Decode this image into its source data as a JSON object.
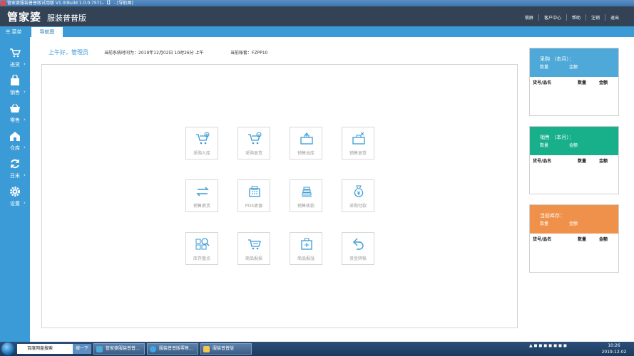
{
  "window": {
    "title": "管家婆服装普普版试用版 V1.0(Build 1.0.0.757)--【】 - [导航图]"
  },
  "header": {
    "logo": "管家婆",
    "edition": "服装普普版",
    "menu": [
      "锁屏",
      "客户中心",
      "帮助",
      "注销",
      "退出"
    ]
  },
  "tabs": {
    "menu_label": "菜单",
    "active_tab": "导航图"
  },
  "sidebar": {
    "items": [
      {
        "label": "进货",
        "icon": "cart-icon"
      },
      {
        "label": "销售",
        "icon": "bag-icon"
      },
      {
        "label": "零售",
        "icon": "basket-icon"
      },
      {
        "label": "仓库",
        "icon": "warehouse-icon"
      },
      {
        "label": "日末",
        "icon": "refresh-icon"
      },
      {
        "label": "设置",
        "icon": "gear-icon"
      }
    ]
  },
  "main": {
    "greeting": "上午好，管理员",
    "systime_label": "当前系统时间为：",
    "systime": "2019年12月02日 10时26分 上午",
    "account_label": "当前账套：",
    "account": "FZPP10"
  },
  "tiles": [
    {
      "label": "采购入库",
      "icon": "cart-add-icon"
    },
    {
      "label": "采购退货",
      "icon": "cart-return-icon"
    },
    {
      "label": "销售出库",
      "icon": "sale-out-icon"
    },
    {
      "label": "销售退货",
      "icon": "sale-return-icon"
    },
    {
      "label": "销售换货",
      "icon": "exchange-icon"
    },
    {
      "label": "POS收银",
      "icon": "pos-icon"
    },
    {
      "label": "销售收款",
      "icon": "receive-money-icon"
    },
    {
      "label": "采购付款",
      "icon": "pay-money-icon"
    },
    {
      "label": "库存盘点",
      "icon": "inventory-check-icon"
    },
    {
      "label": "商品报损",
      "icon": "goods-loss-icon"
    },
    {
      "label": "商品报溢",
      "icon": "goods-overflow-icon"
    },
    {
      "label": "资金转帐",
      "icon": "fund-transfer-icon"
    }
  ],
  "cards": [
    {
      "title": "采购 （本月）：",
      "qty_label": "数量",
      "amount_label": "金额",
      "col_name": "货号/品名",
      "col_qty": "数量",
      "col_amount": "金额",
      "color": "#4fa9d8"
    },
    {
      "title": "销售 （本月）：",
      "qty_label": "数量",
      "amount_label": "金额",
      "col_name": "货号/品名",
      "col_qty": "数量",
      "col_amount": "金额",
      "color": "#17b08a"
    },
    {
      "title": "当前库存：",
      "qty_label": "数量",
      "amount_label": "金额",
      "col_name": "货号/品名",
      "col_qty": "数量",
      "col_amount": "金额",
      "color": "#f0914b"
    }
  ],
  "taskbar": {
    "search_text": "百度网盘搜索",
    "search_button": "搜一下",
    "tasks": [
      "管家婆服装普普...",
      "服装普普版零售...",
      "服装普普版"
    ],
    "time": "10:26",
    "date": "2019-12-02"
  },
  "colors": {
    "header": "#334355",
    "accent": "#3a9bd6",
    "taskbar": "#1b3a5e"
  }
}
